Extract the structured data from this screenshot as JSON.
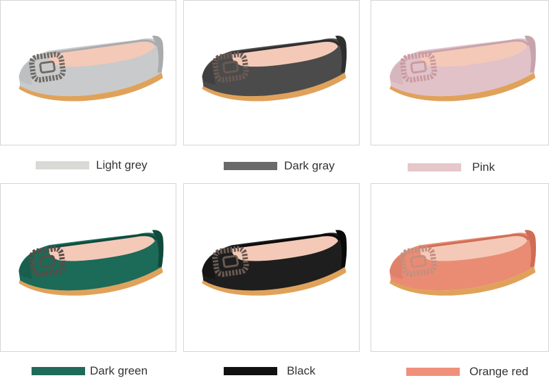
{
  "variants": [
    {
      "label": "Light grey",
      "swatch": "#d9d9d6",
      "upper": "#c9cacb",
      "upper_dark": "#a9abad",
      "buckle": "#6e6a66"
    },
    {
      "label": "Dark gray",
      "swatch": "#6a6a6a",
      "upper": "#4b4b4b",
      "upper_dark": "#2f2f2f",
      "buckle": "#6a5a52"
    },
    {
      "label": "Pink",
      "swatch": "#e6c7ca",
      "upper": "#e0c2c8",
      "upper_dark": "#c7a3ab",
      "buckle": "#c99aa0"
    },
    {
      "label": "Dark green",
      "swatch": "#1f6b5a",
      "upper": "#1c6a58",
      "upper_dark": "#104a3d",
      "buckle": "#5a4c46"
    },
    {
      "label": "Black",
      "swatch": "#111111",
      "upper": "#1e1e1e",
      "upper_dark": "#0a0a0a",
      "buckle": "#6a5a52"
    },
    {
      "label": "Orange red",
      "swatch": "#f0907a",
      "upper": "#ea8c74",
      "upper_dark": "#cf6d57",
      "buckle": "#c48f80"
    }
  ],
  "colors": {
    "lining": "#f4c9b8",
    "sole": "#e0a25a",
    "border": "#d4d4d4",
    "text": "#333333"
  }
}
